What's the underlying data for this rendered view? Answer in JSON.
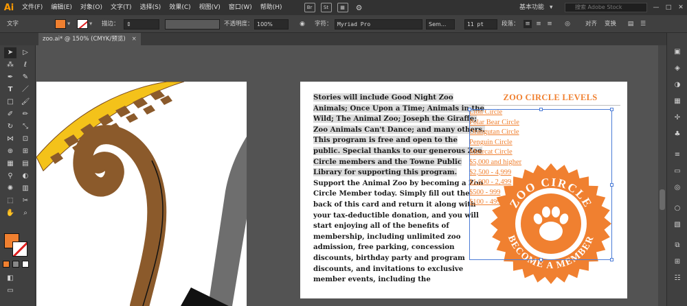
{
  "app": {
    "logo": "Ai",
    "menu": [
      "文件(F)",
      "编辑(E)",
      "对象(O)",
      "文字(T)",
      "选择(S)",
      "效果(C)",
      "视图(V)",
      "窗口(W)",
      "帮助(H)"
    ],
    "menu_icons": [
      "Br",
      "St",
      "grid-icon",
      "gpu-icon"
    ],
    "workspace": "基本功能",
    "stock_search_placeholder": "搜索 Adobe Stock",
    "window_controls": [
      "—",
      "□",
      "✕"
    ]
  },
  "control_bar": {
    "tool_label": "文字",
    "stroke_label": "描边：",
    "opacity_label": "不透明度：",
    "opacity_value": "100%",
    "char_label": "字符：",
    "font_family": "Myriad Pro",
    "font_style": "Sem...",
    "font_size": "11 pt",
    "paragraph_label": "段落：",
    "align_label": "对齐",
    "transform_label": "变换",
    "fill_color": "#f08030",
    "stroke_color": "none"
  },
  "document": {
    "tab_title": "zoo.ai* @ 150% (CMYK/预览)",
    "tab_close": "×"
  },
  "artboard": {
    "body_text_highlighted": "Stories will include Good Night Zoo Animals; Once Upon a Time; Animals in the Wild; The Animal Zoo; Joseph the Giraffe; Zoo Animals Can't Dance; and many others. This program is free and open to the public. Special thanks to our generous Zoo Circle members and the Towne Public Library for supporting this program.",
    "body_text_plain": "Support the Animal Zoo by becoming a Zoo Circle Member today. Simply fill out the back of this card and return it along with your tax-deductible donation, and you will start enjoying all of the benefits of membership, including unlimited zoo admission, free parking, concession discounts, birthday party and program discounts, and invitations to exclusive member events, including the",
    "heading": "ZOO CIRCLE LEVELS",
    "levels": [
      "Lion Circle",
      "Polar Bear Circle",
      "Orangutan Circle",
      "Penguin Circle",
      "Meercat Circle",
      "$5,000  and higher",
      "$2,500 - 4,999",
      "$1,000 - 2,499",
      "$500 - 999",
      "$100 - 499"
    ],
    "seal_top_text": "ZOO CIRCLE",
    "seal_bottom_text": "BECOME A MEMBER",
    "accent_color": "#f08030"
  },
  "tools": [
    "selection-tool",
    "direct-selection-tool",
    "magic-wand-tool",
    "lasso-tool",
    "pen-tool",
    "curvature-tool",
    "type-tool",
    "line-tool",
    "rectangle-tool",
    "paintbrush-tool",
    "shaper-tool",
    "pencil-tool",
    "eraser-tool",
    "rotate-tool",
    "scale-tool",
    "width-tool",
    "free-transform-tool",
    "shape-builder-tool",
    "perspective-tool",
    "mesh-tool",
    "gradient-tool",
    "eyedropper-tool",
    "blend-tool",
    "symbol-sprayer-tool",
    "graph-tool",
    "artboard-tool",
    "slice-tool",
    "hand-tool",
    "zoom-tool"
  ]
}
